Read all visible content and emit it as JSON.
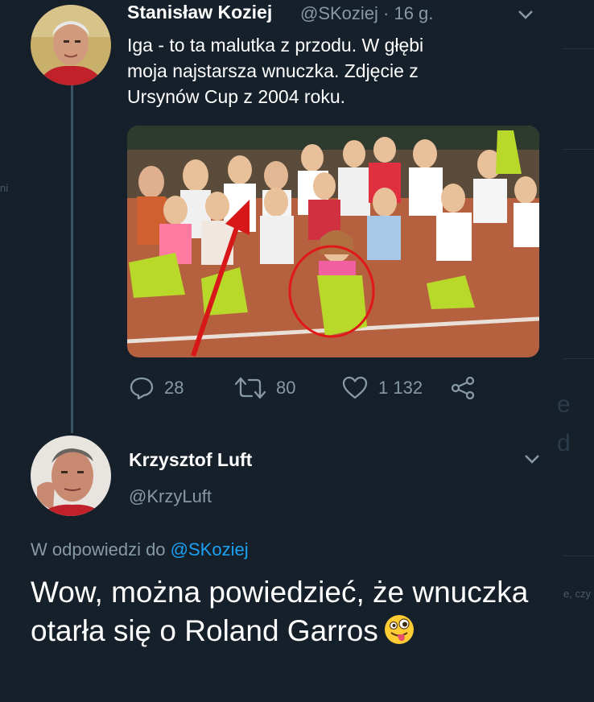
{
  "tweet": {
    "author_name": "Stanisław Koziej",
    "handle_time": "@SKoziej · 16 g.",
    "text": "Iga - to ta malutka z przodu. W głębi\nmoja najstarsza wnuczka. Zdjęcie z\nUrsynów Cup z 2004 roku.",
    "replies": "28",
    "retweets": "80",
    "likes": "1 132"
  },
  "reply": {
    "author_name": "Krzysztof Luft",
    "handle": "@KrzyLuft",
    "reply_prefix": "W odpowiedzi do ",
    "reply_mention": "@SKoziej",
    "text": "Wow, można powiedzieć, że wnuczka otarła się o Roland Garros"
  },
  "background_fragments": {
    "left_letters": "ni",
    "right_letter_1": "e",
    "right_letter_2": "d",
    "right_snippet": "e, czy"
  },
  "colors": {
    "background": "#15202b",
    "text_primary": "#ffffff",
    "text_secondary": "#8899a6",
    "link": "#1da1f2",
    "thread_line": "#3d5466"
  },
  "icons": [
    "chevron-down-icon",
    "reply-icon",
    "retweet-icon",
    "like-icon",
    "share-icon",
    "winking-tongue-emoji"
  ]
}
